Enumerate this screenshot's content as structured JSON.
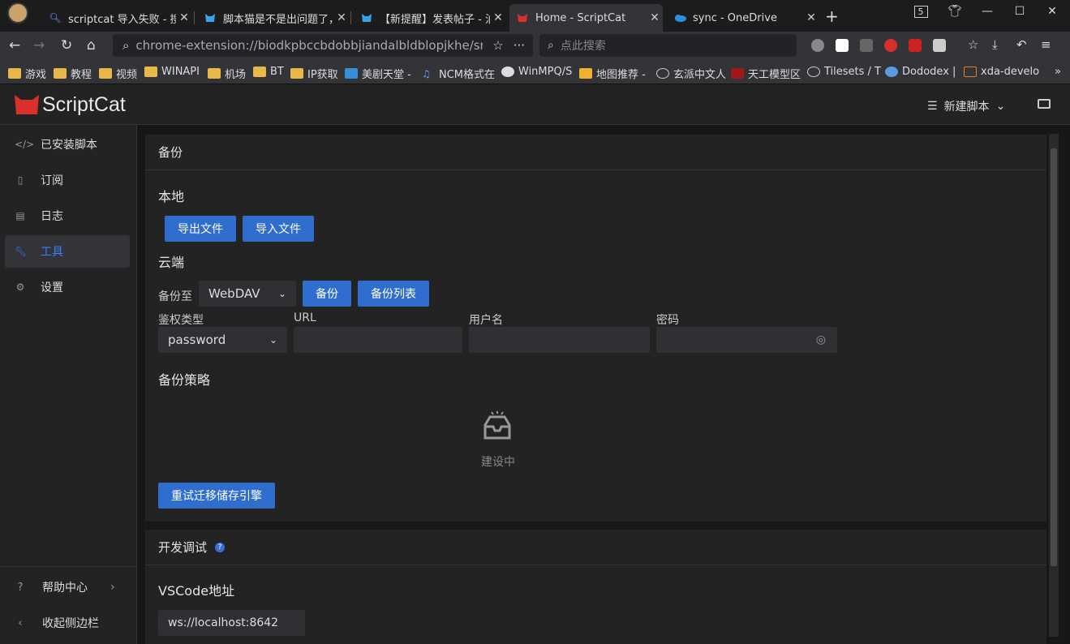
{
  "browser": {
    "tabs": [
      {
        "label": "scriptcat 导入失败 - 搜…",
        "icon": "search-icon",
        "active": false
      },
      {
        "label": "脚本猫是不是出问题了，…",
        "icon": "scriptcat-forum-icon",
        "active": false
      },
      {
        "label": "【新提醒】发表帖子 - 油…",
        "icon": "scriptcat-forum-icon",
        "active": false
      },
      {
        "label": "Home - ScriptCat",
        "icon": "scriptcat-icon",
        "active": true
      },
      {
        "label": "sync - OneDrive",
        "icon": "onedrive-icon",
        "active": false
      }
    ],
    "tab_count": "5",
    "url": "chrome-extension://biodkpbccbdobbjiandalbldblopjkhe/src/c",
    "search_placeholder": "点此搜索",
    "bookmarks": [
      "游戏",
      "教程",
      "视频",
      "WINAPI",
      "机场",
      "BT",
      "IP获取",
      "美剧天堂 -",
      "NCM格式在",
      "WinMPQ/S",
      "地图推荐 -",
      "玄派中文人",
      "天工模型区",
      "Tilesets / T",
      "Dododex |",
      "xda-develo"
    ]
  },
  "app": {
    "logo_text": "ScriptCat",
    "new_script": "新建脚本",
    "sidebar": {
      "items": [
        {
          "label": "已安装脚本",
          "icon": "code-icon"
        },
        {
          "label": "订阅",
          "icon": "bookmark-icon"
        },
        {
          "label": "日志",
          "icon": "file-icon"
        },
        {
          "label": "工具",
          "icon": "tool-icon"
        },
        {
          "label": "设置",
          "icon": "gear-icon"
        }
      ],
      "help": "帮助中心",
      "collapse": "收起侧边栏"
    }
  },
  "backup": {
    "title": "备份",
    "local": "本地",
    "export_btn": "导出文件",
    "import_btn": "导入文件",
    "cloud": "云端",
    "backup_to": "备份至",
    "provider": "WebDAV",
    "backup_btn": "备份",
    "backup_list_btn": "备份列表",
    "auth_type_label": "鉴权类型",
    "auth_type": "password",
    "url_label": "URL",
    "username_label": "用户名",
    "password_label": "密码",
    "strategy": "备份策略",
    "empty_text": "建设中",
    "retry_btn": "重试迁移储存引擎"
  },
  "dev": {
    "title": "开发调试",
    "vscode_label": "VSCode地址",
    "vscode_value": "ws://localhost:8642"
  },
  "colors": {
    "accent": "#2f6ecf",
    "active_text": "#3c7eff",
    "bg": "#232324"
  }
}
